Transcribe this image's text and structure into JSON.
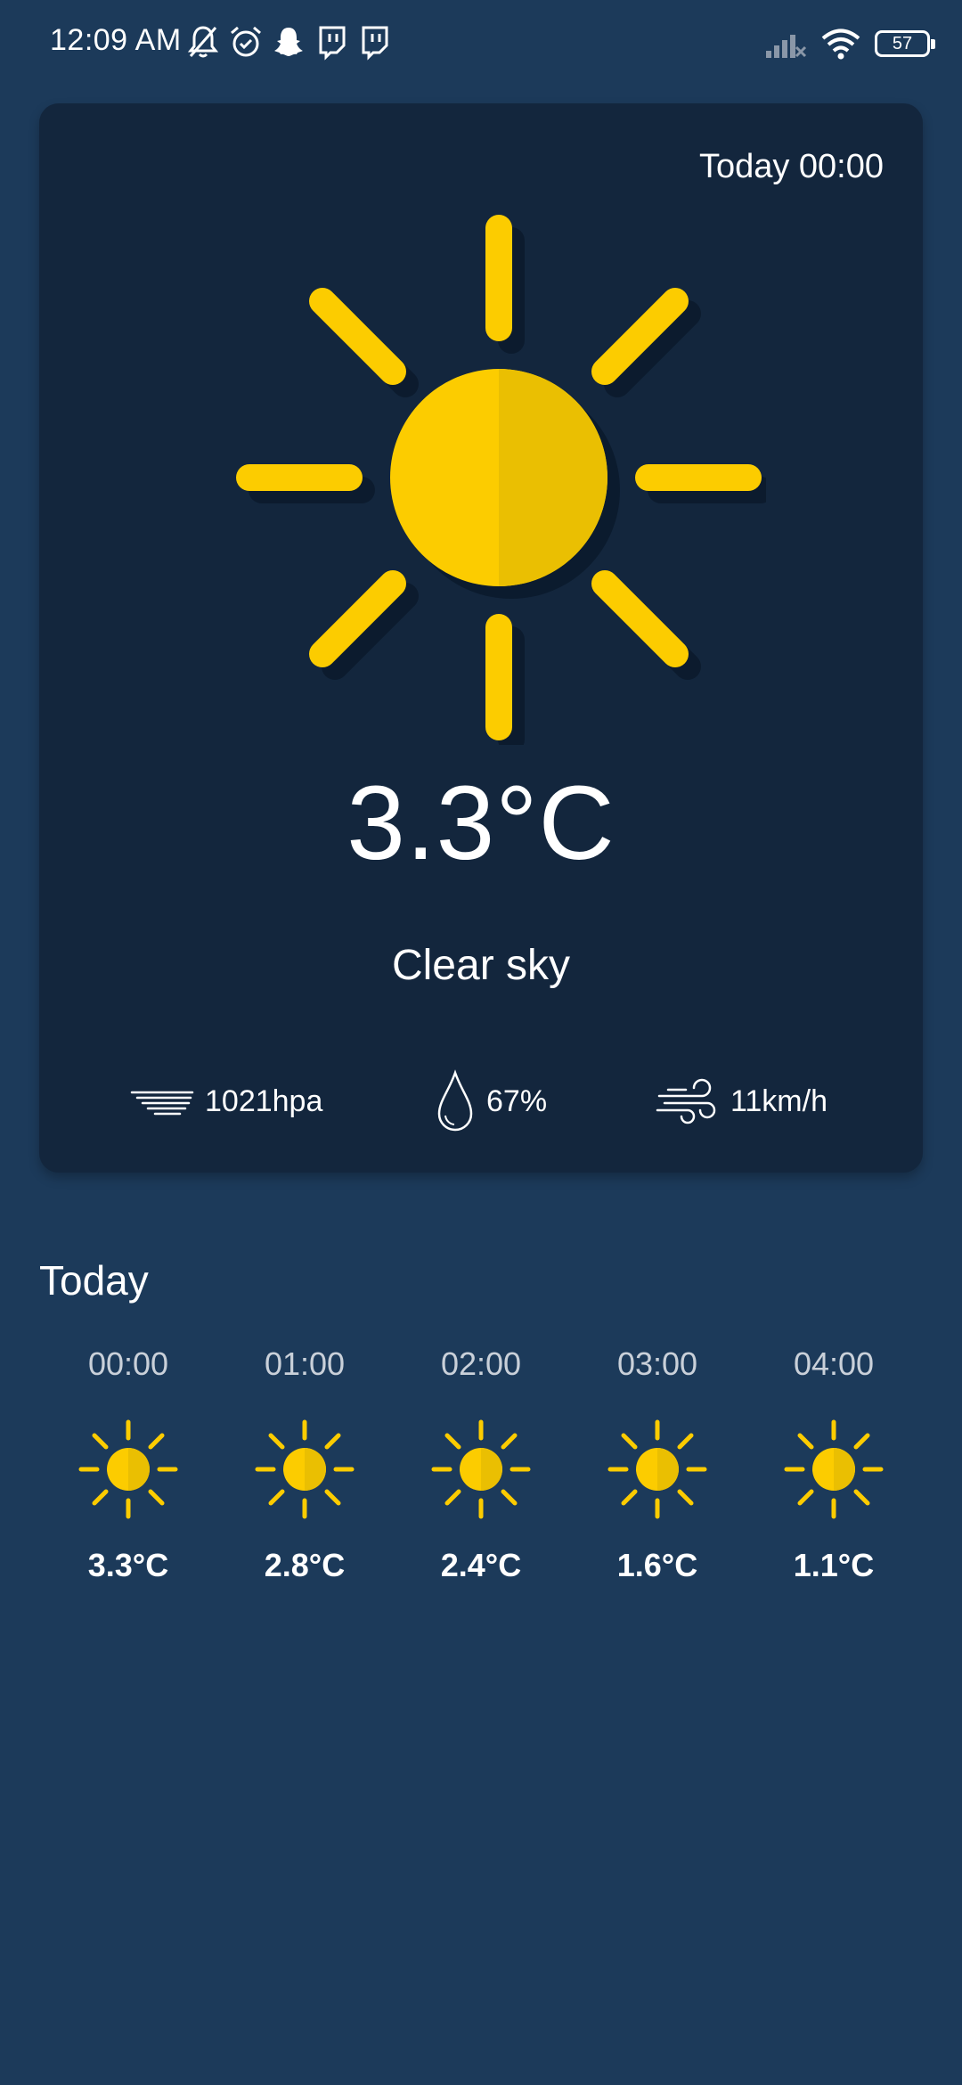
{
  "status_bar": {
    "time": "12:09 AM",
    "battery": "57",
    "left_icons": [
      "bell-off-icon",
      "alarm-icon",
      "snapchat-icon",
      "twitch-icon",
      "twitch-icon"
    ],
    "right_icons": [
      "signal-off-icon",
      "wifi-icon",
      "battery-icon"
    ]
  },
  "current": {
    "timestamp": "Today 00:00",
    "temperature": "3.3°C",
    "condition": "Clear sky",
    "icon": "clear-sky-sun-icon",
    "pressure": "1021hpa",
    "humidity": "67%",
    "wind": "11km/h"
  },
  "today": {
    "title": "Today",
    "hours": [
      {
        "time": "00:00",
        "temp": "3.3°C",
        "icon": "sun-icon"
      },
      {
        "time": "01:00",
        "temp": "2.8°C",
        "icon": "sun-icon"
      },
      {
        "time": "02:00",
        "temp": "2.4°C",
        "icon": "sun-icon"
      },
      {
        "time": "03:00",
        "temp": "1.6°C",
        "icon": "sun-icon"
      },
      {
        "time": "04:00",
        "temp": "1.1°C",
        "icon": "sun-icon"
      }
    ]
  },
  "colors": {
    "background": "#1c3a5a",
    "card": "#13263d",
    "sun_light": "#fccc00",
    "sun_dark": "#eabf02"
  }
}
